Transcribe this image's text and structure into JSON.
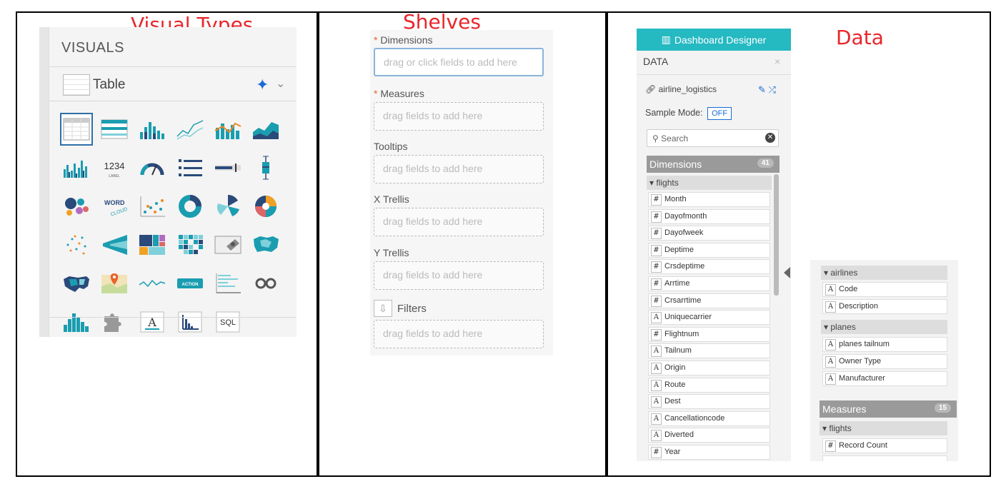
{
  "annotations": {
    "visual_types": "Visual Types",
    "shelves": "Shelves",
    "data": "Data"
  },
  "visuals_panel": {
    "title": "VISUALS",
    "selected_visual": "Table",
    "grid_icons": [
      "table-icon",
      "cross-tab-icon",
      "bar-chart-icon",
      "line-chart-icon",
      "combo-bar-line-icon",
      "area-chart-icon",
      "grouped-bar-icon",
      "kpi-icon",
      "gauge-icon",
      "list-icon",
      "bullet-icon",
      "box-plot-icon",
      "packed-bubbles-icon",
      "word-cloud-icon",
      "scatter-icon",
      "donut-icon",
      "radial-icon",
      "sunburst-icon",
      "network-icon",
      "funnel-icon",
      "treemap-icon",
      "heatmap-icon",
      "image-icon",
      "map-icon",
      "us-map-icon",
      "geo-map-icon",
      "sparkline-icon",
      "action-icon",
      "rich-text-icon",
      "chord-icon",
      "histogram-icon",
      "extension-icon",
      "text-icon",
      "trellis-icon",
      "sql-icon"
    ],
    "kpi_label": "1234",
    "kpi_sub": "LABEL",
    "word_cloud_text": "WORD",
    "action_text": "ACTION",
    "sql_text": "SQL",
    "text_glyph": "A"
  },
  "shelves_panel": {
    "shelves": [
      {
        "label": "Dimensions",
        "required": true,
        "placeholder": "drag or click fields to add here"
      },
      {
        "label": "Measures",
        "required": true,
        "placeholder": "drag fields to add here"
      },
      {
        "label": "Tooltips",
        "required": false,
        "placeholder": "drag fields to add here"
      },
      {
        "label": "X Trellis",
        "required": false,
        "placeholder": "drag fields to add here"
      },
      {
        "label": "Y Trellis",
        "required": false,
        "placeholder": "drag fields to add here"
      },
      {
        "label": "Filters",
        "required": false,
        "placeholder": "drag fields to add here"
      }
    ],
    "required_marker": "*"
  },
  "data_panel": {
    "header": "Dashboard Designer",
    "title": "DATA",
    "close": "×",
    "dataset": "airline_logistics",
    "sample_mode_label": "Sample Mode:",
    "sample_mode_value": "OFF",
    "search_placeholder": "Search",
    "dimensions_label": "Dimensions",
    "dimensions_count": "41",
    "groups": [
      {
        "name": "flights",
        "fields": [
          {
            "type": "#",
            "name": "Month"
          },
          {
            "type": "#",
            "name": "Dayofmonth"
          },
          {
            "type": "#",
            "name": "Dayofweek"
          },
          {
            "type": "#",
            "name": "Deptime"
          },
          {
            "type": "#",
            "name": "Crsdeptime"
          },
          {
            "type": "#",
            "name": "Arrtime"
          },
          {
            "type": "#",
            "name": "Crsarrtime"
          },
          {
            "type": "A",
            "name": "Uniquecarrier"
          },
          {
            "type": "#",
            "name": "Flightnum"
          },
          {
            "type": "A",
            "name": "Tailnum"
          },
          {
            "type": "A",
            "name": "Origin"
          },
          {
            "type": "A",
            "name": "Route"
          },
          {
            "type": "A",
            "name": "Dest"
          },
          {
            "type": "A",
            "name": "Cancellationcode"
          },
          {
            "type": "A",
            "name": "Diverted"
          },
          {
            "type": "#",
            "name": "Year"
          }
        ]
      }
    ],
    "continued_groups": [
      {
        "name": "airlines",
        "fields": [
          {
            "type": "A",
            "name": "Code"
          },
          {
            "type": "A",
            "name": "Description"
          }
        ]
      },
      {
        "name": "planes",
        "fields": [
          {
            "type": "A",
            "name": "planes tailnum"
          },
          {
            "type": "A",
            "name": "Owner Type"
          },
          {
            "type": "A",
            "name": "Manufacturer"
          }
        ]
      }
    ],
    "measures_label": "Measures",
    "measures_count": "15",
    "measure_groups": [
      {
        "name": "flights",
        "fields": [
          {
            "type": "#",
            "name": "Record Count"
          }
        ]
      }
    ]
  }
}
